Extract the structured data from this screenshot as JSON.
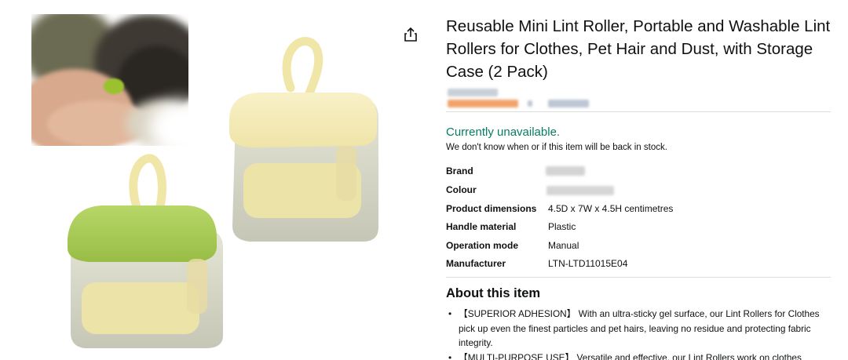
{
  "product": {
    "title": "Reusable Mini Lint Roller, Portable and Washable Lint Rollers for Clothes, Pet Hair and Dust, with Storage Case (2 Pack)"
  },
  "availability": {
    "status": "Currently unavailable.",
    "note": "We don't know when or if this item will be back in stock."
  },
  "specs": [
    {
      "label": "Brand",
      "value": ""
    },
    {
      "label": "Colour",
      "value": ""
    },
    {
      "label": "Product dimensions",
      "value": "4.5D x 7W x 4.5H centimetres"
    },
    {
      "label": "Handle material",
      "value": "Plastic"
    },
    {
      "label": "Operation mode",
      "value": "Manual"
    },
    {
      "label": "Manufacturer",
      "value": "LTN-LTD11015E04"
    }
  ],
  "about": {
    "heading": "About this item",
    "bullets": [
      "【SUPERIOR ADHESION】 With an ultra-sticky gel surface, our Lint Rollers for Clothes pick up even the finest particles and pet hairs, leaving no residue and protecting fabric integrity.",
      "【MULTI-PURPOSE USE】 Versatile and effective, our Lint Rollers work on clothes"
    ]
  },
  "icons": {
    "share": "share-icon"
  },
  "colors": {
    "availability": "#067d62",
    "text": "#0f1111",
    "divider": "#dddddd"
  }
}
